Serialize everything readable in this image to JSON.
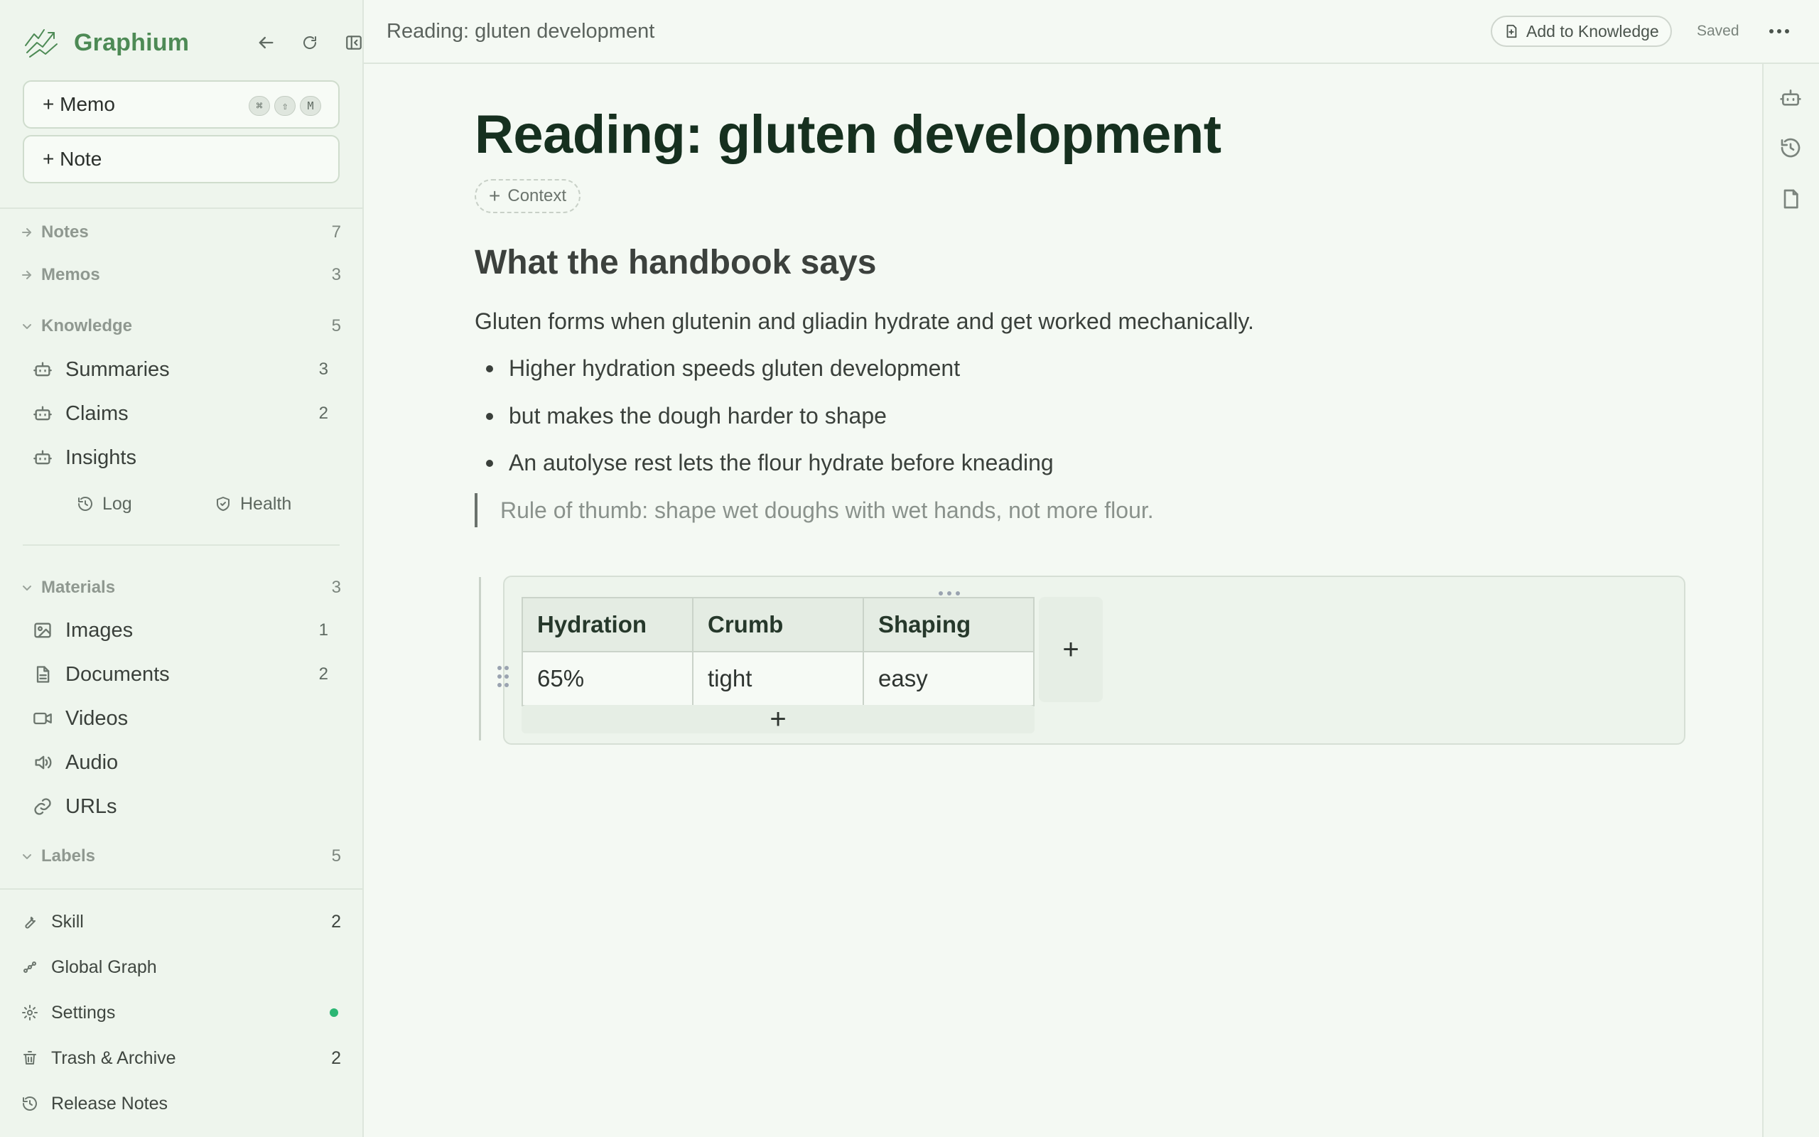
{
  "app": {
    "name": "Graphium",
    "brand_color": "#4d8a55"
  },
  "sidebar": {
    "create": {
      "memo_label": "+ Memo",
      "memo_shortcut": [
        "⌘",
        "⇧",
        "M"
      ],
      "note_label": "+ Note"
    },
    "sections": {
      "notes": {
        "label": "Notes",
        "count": "7"
      },
      "memos": {
        "label": "Memos",
        "count": "3"
      },
      "knowledge": {
        "label": "Knowledge",
        "count": "5",
        "items": [
          {
            "label": "Summaries",
            "count": "3",
            "icon": "bot-icon"
          },
          {
            "label": "Claims",
            "count": "2",
            "icon": "bot-icon"
          },
          {
            "label": "Insights",
            "count": "",
            "icon": "bot-icon"
          }
        ],
        "links": [
          {
            "label": "Log",
            "icon": "history-icon"
          },
          {
            "label": "Health",
            "icon": "shield-check-icon"
          }
        ]
      },
      "materials": {
        "label": "Materials",
        "count": "3",
        "items": [
          {
            "label": "Images",
            "count": "1",
            "icon": "image-icon"
          },
          {
            "label": "Documents",
            "count": "2",
            "icon": "document-icon"
          },
          {
            "label": "Videos",
            "count": "",
            "icon": "video-icon"
          },
          {
            "label": "Audio",
            "count": "",
            "icon": "audio-icon"
          },
          {
            "label": "URLs",
            "count": "",
            "icon": "link-icon"
          }
        ]
      },
      "labels": {
        "label": "Labels",
        "count": "5"
      }
    },
    "footer": [
      {
        "label": "Skill",
        "count": "2",
        "icon": "wrench-icon"
      },
      {
        "label": "Global Graph",
        "count": "",
        "icon": "graph-icon"
      },
      {
        "label": "Settings",
        "count": "",
        "icon": "gear-icon",
        "status_dot_color": "#2bb673"
      },
      {
        "label": "Trash & Archive",
        "count": "2",
        "icon": "trash-icon"
      },
      {
        "label": "Release Notes",
        "count": "",
        "icon": "history-icon"
      }
    ]
  },
  "header": {
    "crumb": "Reading: gluten development",
    "add_to_knowledge": "Add to Knowledge",
    "save_status": "Saved"
  },
  "document": {
    "title": "Reading: gluten development",
    "context_label": "Context",
    "heading": "What the handbook says",
    "paragraph": "Gluten forms when glutenin and gliadin hydrate and get worked mechanically.",
    "bullets": [
      "Higher hydration speeds gluten development",
      "but makes the dough harder to shape",
      "An autolyse rest lets the flour hydrate before kneading"
    ],
    "quote": "Rule of thumb: shape wet doughs with wet hands, not more flour.",
    "table": {
      "headers": [
        "Hydration",
        "Crumb",
        "Shaping"
      ],
      "rows": [
        [
          "65%",
          "tight",
          "easy"
        ]
      ],
      "add_symbol": "+"
    }
  },
  "rail": [
    "bot-icon",
    "history-icon",
    "file-icon"
  ]
}
